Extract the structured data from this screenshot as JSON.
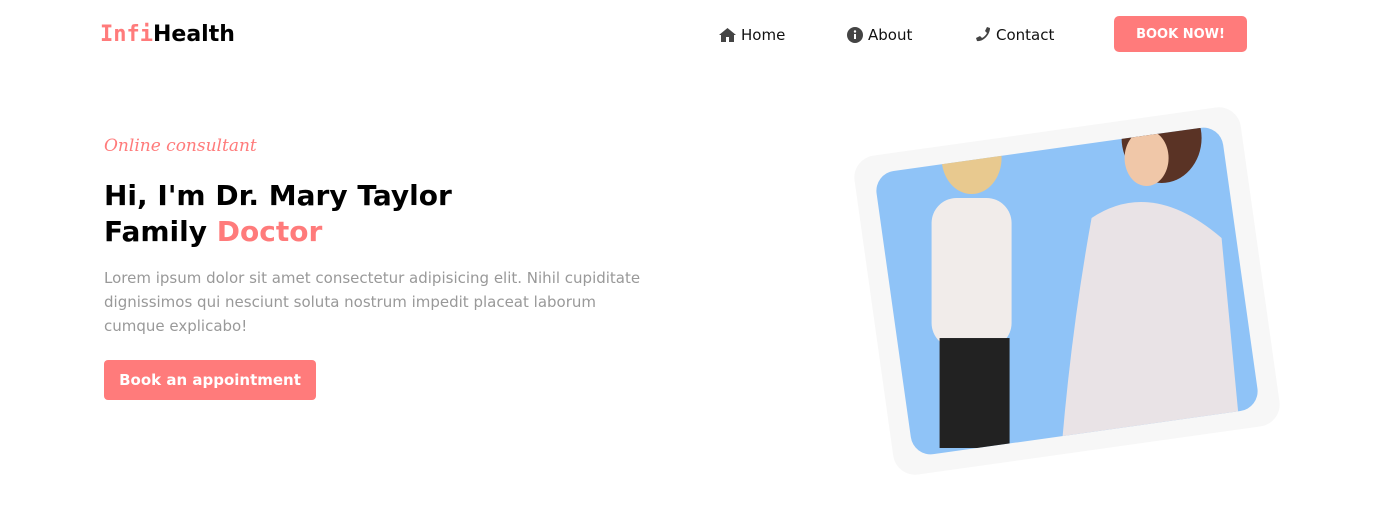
{
  "header": {
    "logo_a": "Infi",
    "logo_b": "Health",
    "nav": [
      {
        "label": "Home",
        "icon": "home-icon"
      },
      {
        "label": "About",
        "icon": "info-icon"
      },
      {
        "label": "Contact",
        "icon": "phone-icon"
      }
    ],
    "cta": "BOOK NOW!"
  },
  "hero": {
    "subtitle": "Online consultant",
    "title_line1": "Hi, I'm Dr. Mary Taylor",
    "title_line2a": "Family ",
    "title_line2b": "Doctor",
    "description": "Lorem ipsum dolor sit amet consectetur adipisicing elit. Nihil cupiditate dignissimos qui nesciunt soluta nostrum impedit placeat laborum cumque explicabo!",
    "button": "Book an appointment"
  },
  "colors": {
    "accent": "#ff7b7b",
    "photo_bg": "#8fc3f7"
  }
}
